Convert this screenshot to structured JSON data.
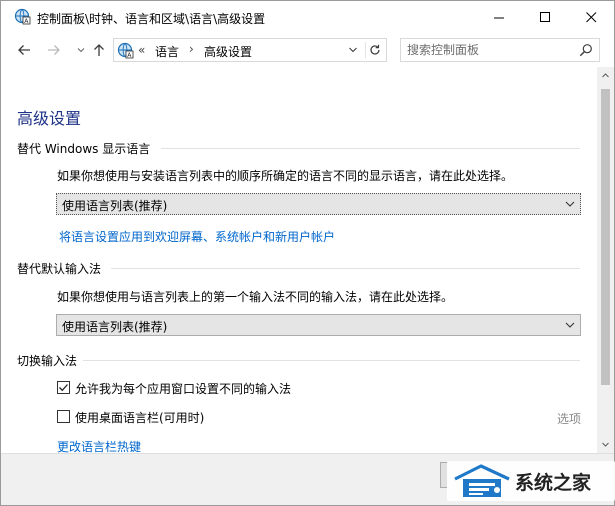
{
  "window": {
    "title": "控制面板\\时钟、语言和区域\\语言\\高级设置"
  },
  "address_bar": {
    "overflow_marker": "«",
    "crumbs": [
      "语言",
      "高级设置"
    ],
    "separator": "›"
  },
  "search": {
    "placeholder": "搜索控制面板"
  },
  "page": {
    "title": "高级设置",
    "display_language": {
      "heading": "替代 Windows 显示语言",
      "description": "如果你想使用与安装语言列表中的顺序所确定的语言不同的显示语言，请在此处选择。",
      "selected": "使用语言列表(推荐)",
      "apply_link": "将语言设置应用到欢迎屏幕、系统帐户和新用户帐户"
    },
    "input_method": {
      "heading": "替代默认输入法",
      "description": "如果你想使用与语言列表上的第一个输入法不同的输入法，请在此处选择。",
      "selected": "使用语言列表(推荐)"
    },
    "switching": {
      "heading": "切换输入法",
      "per_app_label": "允许我为每个应用窗口设置不同的输入法",
      "per_app_checked": true,
      "desktop_bar_label": "使用桌面语言栏(可用时)",
      "desktop_bar_checked": false,
      "options_label": "选项",
      "hotkey_link": "更改语言栏热键"
    }
  },
  "watermark": {
    "text": "系统之家"
  },
  "colors": {
    "title_blue": "#1e3287",
    "link_blue": "#0066cc",
    "disabled_gray": "#8a8a8a"
  }
}
